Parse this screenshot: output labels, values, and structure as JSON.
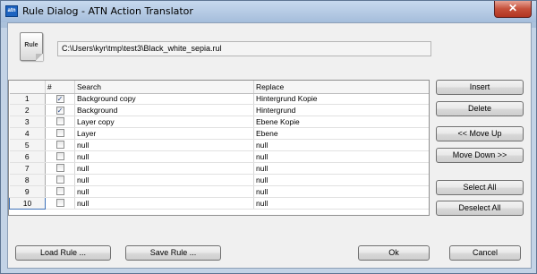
{
  "window": {
    "app_icon_text": "atn",
    "title": "Rule Dialog - ATN Action Translator",
    "close_glyph": "✕"
  },
  "rule_icon_label": "Rule",
  "path": "C:\\Users\\kyr\\tmp\\test3\\Black_white_sepia.rul",
  "table": {
    "headers": {
      "num": "",
      "check": "#",
      "search": "Search",
      "replace": "Replace"
    },
    "rows": [
      {
        "n": "1",
        "checked": "✓",
        "search": "Background copy",
        "replace": "Hintergrund Kopie"
      },
      {
        "n": "2",
        "checked": "✓",
        "search": "Background",
        "replace": "Hintergrund"
      },
      {
        "n": "3",
        "checked": "",
        "search": "Layer copy",
        "replace": "Ebene Kopie"
      },
      {
        "n": "4",
        "checked": "",
        "search": "Layer",
        "replace": "Ebene"
      },
      {
        "n": "5",
        "checked": "",
        "search": "null",
        "replace": "null"
      },
      {
        "n": "6",
        "checked": "",
        "search": "null",
        "replace": "null"
      },
      {
        "n": "7",
        "checked": "",
        "search": "null",
        "replace": "null"
      },
      {
        "n": "8",
        "checked": "",
        "search": "null",
        "replace": "null"
      },
      {
        "n": "9",
        "checked": "",
        "search": "null",
        "replace": "null"
      },
      {
        "n": "10",
        "checked": "",
        "search": "null",
        "replace": "null"
      }
    ]
  },
  "side_buttons": {
    "insert": "Insert",
    "delete": "Delete",
    "move_up": "<< Move Up",
    "move_down": "Move Down >>",
    "select_all": "Select All",
    "deselect_all": "Deselect All"
  },
  "bottom_buttons": {
    "load_rule": "Load Rule ...",
    "save_rule": "Save Rule ...",
    "ok": "Ok",
    "cancel": "Cancel"
  }
}
